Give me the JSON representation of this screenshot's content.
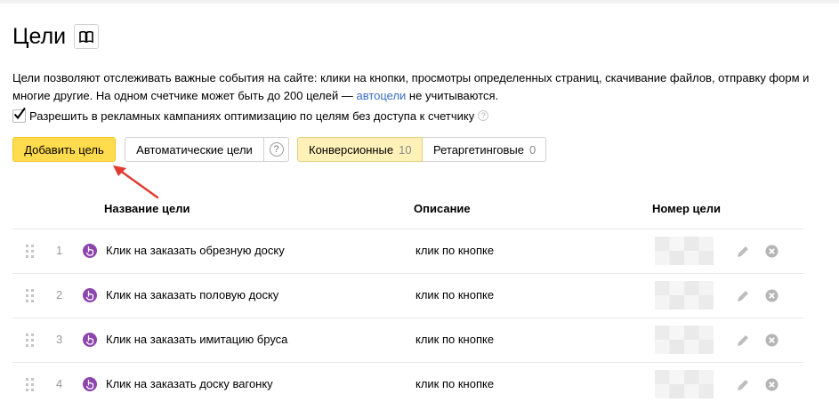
{
  "page": {
    "title": "Цели",
    "description_part1": "Цели позволяют отслеживать важные события на сайте: клики на кнопки, просмотры определенных страниц, скачивание файлов, отправку форм и многие другие. На одном счетчике может быть до 200 целей — ",
    "description_link": "автоцели",
    "description_part2": " не учитываются.",
    "permission_label": "Разрешить в рекламных кампаниях оптимизацию по целям без доступа к счетчику",
    "help_mark": "?"
  },
  "toolbar": {
    "add_label": "Добавить цель",
    "auto_label": "Автоматические цели",
    "help_mark": "?",
    "tabs": [
      {
        "label": "Конверсионные",
        "count": "10"
      },
      {
        "label": "Ретаргетинговые",
        "count": "0"
      }
    ]
  },
  "table": {
    "headers": {
      "name": "Название цели",
      "description": "Описание",
      "goal_id": "Номер цели"
    },
    "rows": [
      {
        "num": "1",
        "name": "Клик на заказать обрезную доску",
        "description": "клик по кнопке"
      },
      {
        "num": "2",
        "name": "Клик на заказать половую доску",
        "description": "клик по кнопке"
      },
      {
        "num": "3",
        "name": "Клик на заказать имитацию бруса",
        "description": "клик по кнопке"
      },
      {
        "num": "4",
        "name": "Клик на заказать доску вагонку",
        "description": "клик по кнопке"
      }
    ]
  },
  "colors": {
    "accent": "#ffdb4d",
    "link": "#3b6ec4",
    "goal_icon": "#8e44ad",
    "arrow": "#e03c31"
  },
  "icons": [
    "book-icon",
    "check-icon",
    "help-icon",
    "drag-handle-icon",
    "click-goal-icon",
    "pencil-icon",
    "close-circle-icon",
    "red-arrow-annotation"
  ]
}
